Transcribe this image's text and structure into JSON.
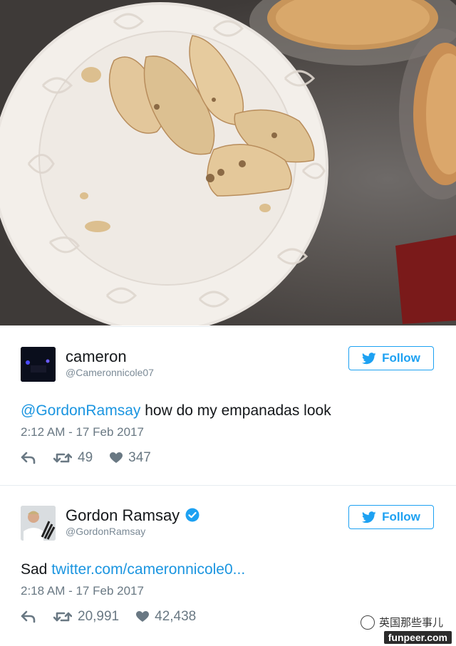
{
  "tweets": [
    {
      "name": "cameron",
      "handle": "@Cameronnicole07",
      "follow_label": "Follow",
      "mention": "@GordonRamsay",
      "body": " how do my empanadas look",
      "time": "2:12 AM - 17 Feb 2017",
      "retweets": "49",
      "likes": "347"
    },
    {
      "name": "Gordon Ramsay",
      "verified": true,
      "handle": "@GordonRamsay",
      "follow_label": "Follow",
      "prefix": "Sad ",
      "link": "twitter.com/cameronnicole0...",
      "time": "2:18 AM - 17 Feb 2017",
      "retweets": "20,991",
      "likes": "42,438"
    }
  ],
  "watermark": {
    "wechat_name": "英国那些事儿",
    "site": "funpeer.com"
  },
  "colors": {
    "twitter_blue": "#1da1f2",
    "link_blue": "#1b95e0",
    "muted": "#697883"
  }
}
